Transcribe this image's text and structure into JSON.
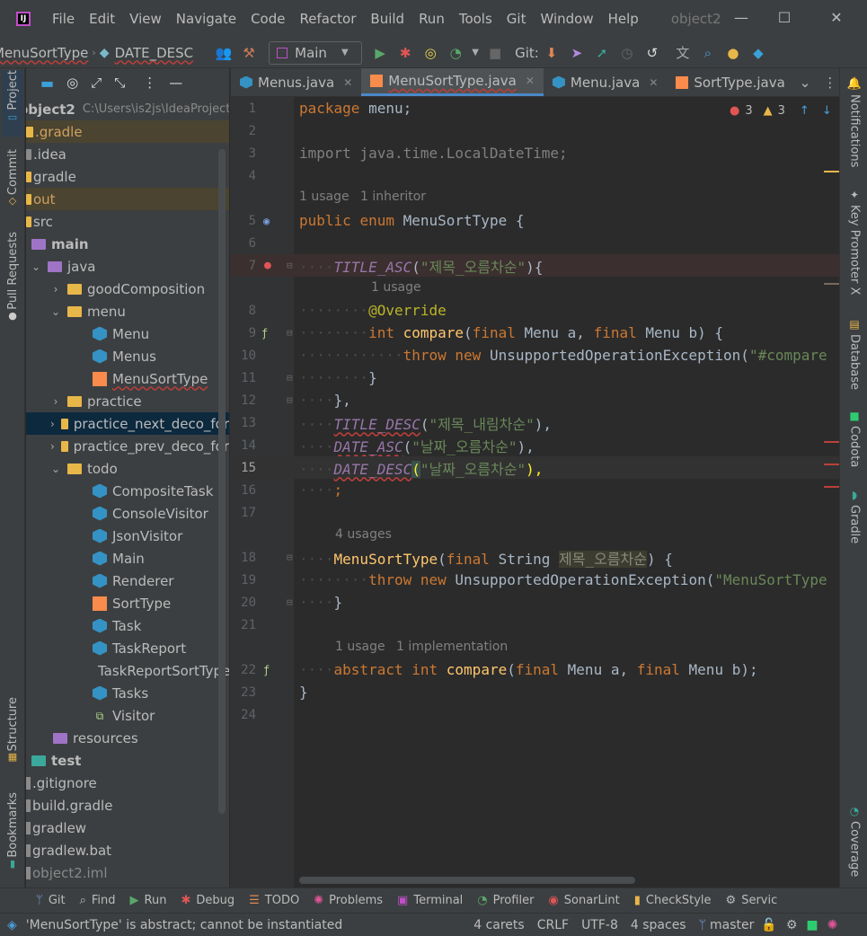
{
  "menubar": {
    "items": [
      "File",
      "Edit",
      "View",
      "Navigate",
      "Code",
      "Refactor",
      "Build",
      "Run",
      "Tools",
      "Git",
      "Window",
      "Help"
    ],
    "project": "object2"
  },
  "toolbar": {
    "breadcrumb1": "MenuSortType",
    "breadcrumb2": "DATE_DESC",
    "run_config": "Main",
    "git_label": "Git:"
  },
  "left_strip": {
    "project": "Project",
    "commit": "Commit",
    "pull_requests": "Pull Requests",
    "structure": "Structure",
    "bookmarks": "Bookmarks"
  },
  "right_strip": {
    "notifications": "Notifications",
    "key_promoter": "Key Promoter X",
    "database": "Database",
    "codota": "Codota",
    "gradle": "Gradle",
    "coverage": "Coverage"
  },
  "project_tree": {
    "root_name": "object2",
    "root_path": "C:\\Users\\is2js\\IdeaProject",
    "rows": [
      {
        "label": ".gradle"
      },
      {
        "label": ".idea"
      },
      {
        "label": "gradle"
      },
      {
        "label": "out"
      },
      {
        "label": "src"
      },
      {
        "label": "main"
      },
      {
        "label": "java"
      },
      {
        "label": "goodComposition"
      },
      {
        "label": "menu"
      },
      {
        "label": "Menu"
      },
      {
        "label": "Menus"
      },
      {
        "label": "MenuSortType"
      },
      {
        "label": "practice"
      },
      {
        "label": "practice_next_deco_for"
      },
      {
        "label": "practice_prev_deco_for"
      },
      {
        "label": "todo"
      },
      {
        "label": "CompositeTask"
      },
      {
        "label": "ConsoleVisitor"
      },
      {
        "label": "JsonVisitor"
      },
      {
        "label": "Main"
      },
      {
        "label": "Renderer"
      },
      {
        "label": "SortType"
      },
      {
        "label": "Task"
      },
      {
        "label": "TaskReport"
      },
      {
        "label": "TaskReportSortType"
      },
      {
        "label": "Tasks"
      },
      {
        "label": "Visitor"
      },
      {
        "label": "resources"
      },
      {
        "label": "test"
      },
      {
        "label": ".gitignore"
      },
      {
        "label": "build.gradle"
      },
      {
        "label": "gradlew"
      },
      {
        "label": "gradlew.bat"
      },
      {
        "label": "object2.iml"
      }
    ]
  },
  "tabs": [
    "Menus.java",
    "MenuSortType.java",
    "Menu.java",
    "SortType.java"
  ],
  "inspections": {
    "errors": "3",
    "warnings": "3"
  },
  "code": {
    "l1": [
      "package",
      " menu;"
    ],
    "l3": "import java.time.LocalDateTime;",
    "hint5_usage": "1 usage",
    "hint5_inheritor": "1 inheritor",
    "l5": [
      "public",
      "enum",
      "MenuSortType {"
    ],
    "l7": [
      "TITLE_ASC",
      "(",
      "\"제목_오름차순\"",
      "){"
    ],
    "hint8": "1 usage",
    "l8": "@Override",
    "l9": [
      "int",
      "compare",
      "(",
      "final",
      " Menu a, ",
      "final",
      " Menu b) {"
    ],
    "l10": [
      "throw",
      "new",
      " UnsupportedOperationException(",
      "\"#compare"
    ],
    "l11": "}",
    "l12": "},",
    "l13": [
      "TITLE_DESC",
      "(",
      "\"제목_내림차순\"",
      "),"
    ],
    "l14": [
      "DATE_ASC",
      "(",
      "\"날짜_오름차순\"",
      "),"
    ],
    "l15": [
      "DATE_DESC",
      "(",
      "\"날짜_오름차순\"",
      "),"
    ],
    "l16": ";",
    "hint18": "4 usages",
    "l18": [
      "MenuSortType",
      "(",
      "final",
      " String ",
      "제목_오름차순",
      ") {"
    ],
    "l19": [
      "throw",
      "new",
      " UnsupportedOperationException(",
      "\"MenuSortType"
    ],
    "l20": "}",
    "hint22_usage": "1 usage",
    "hint22_impl": "1 implementation",
    "l22": [
      "abstract",
      "int",
      "compare",
      "(",
      "final",
      " Menu a, ",
      "final",
      " Menu b);"
    ],
    "l23": "}"
  },
  "bottom_tabs": [
    "Git",
    "Find",
    "Run",
    "Debug",
    "TODO",
    "Problems",
    "Terminal",
    "Profiler",
    "SonarLint",
    "CheckStyle",
    "Servic"
  ],
  "status": {
    "message": "'MenuSortType' is abstract; cannot be instantiated",
    "carets": "4 carets",
    "line_sep": "CRLF",
    "encoding": "UTF-8",
    "indent": "4 spaces",
    "branch": "master"
  }
}
